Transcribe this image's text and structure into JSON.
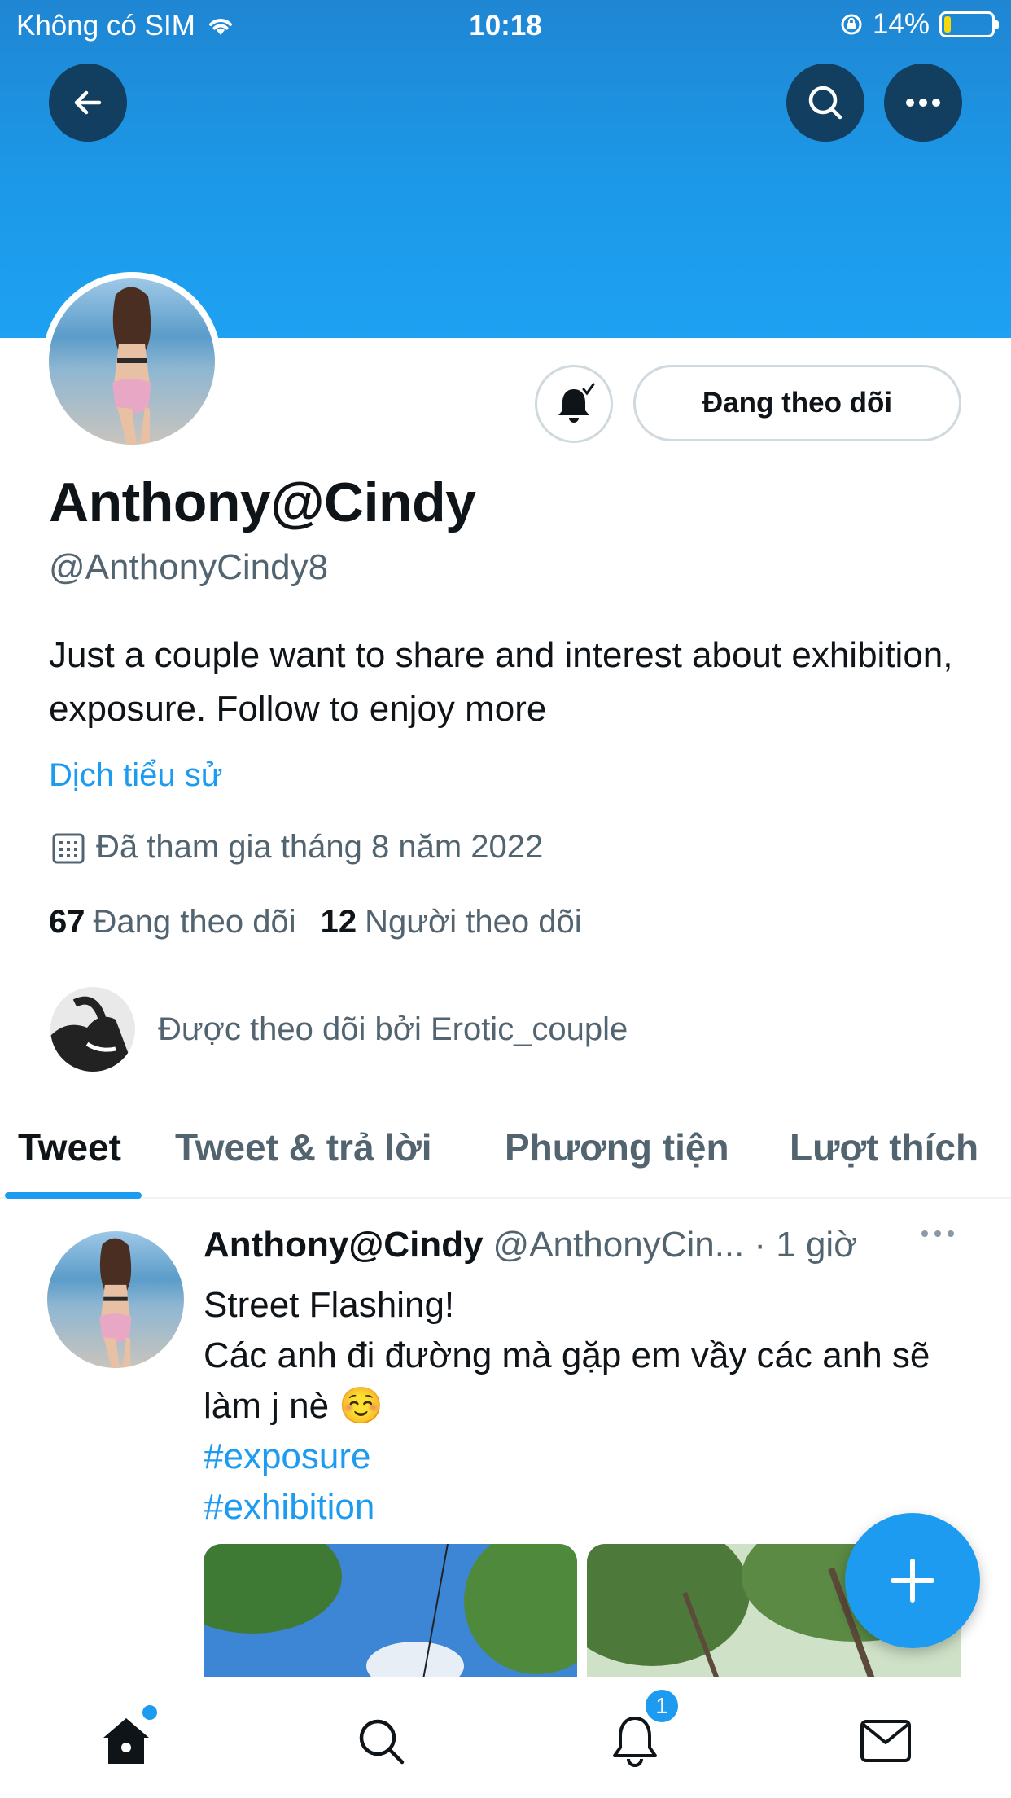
{
  "status_bar": {
    "carrier": "Không có SIM",
    "time": "10:18",
    "battery_percent": "14%",
    "battery_level": 0.14,
    "icons": [
      "wifi-icon",
      "orientation-lock-icon",
      "battery-icon"
    ]
  },
  "profile": {
    "display_name": "Anthony@Cindy",
    "handle": "@AnthonyCindy8",
    "bio": "Just a couple want to share and interest about exhibition, exposure. Follow to enjoy more",
    "translate_label": "Dịch tiểu sử",
    "joined": "Đã tham gia tháng 8 năm 2022",
    "following_count": "67",
    "following_label": "Đang theo dõi",
    "followers_count": "12",
    "followers_label": "Người theo dõi",
    "followed_by": "Được theo dõi bởi Erotic_couple",
    "follow_button_label": "Đang theo dõi"
  },
  "tabs": [
    {
      "label": "Tweet",
      "active": true
    },
    {
      "label": "Tweet & trả lời",
      "active": false
    },
    {
      "label": "Phương tiện",
      "active": false
    },
    {
      "label": "Lượt thích",
      "active": false
    }
  ],
  "tweet": {
    "name": "Anthony@Cindy",
    "handle": "@AnthonyCin...",
    "time": "· 1 giờ",
    "line1": "Street Flashing!",
    "line2": "Các anh đi đường mà gặp em vầy các anh sẽ làm j nè ☺️",
    "hashtags": [
      "#exposure",
      "#exhibition"
    ]
  },
  "bottom_nav": {
    "items": [
      "home-icon",
      "search-icon",
      "notifications-icon",
      "messages-icon"
    ],
    "notification_badge": "1"
  },
  "colors": {
    "accent": "#1d9bf0",
    "banner": "#1c99e8",
    "secondary_text": "#536471"
  }
}
